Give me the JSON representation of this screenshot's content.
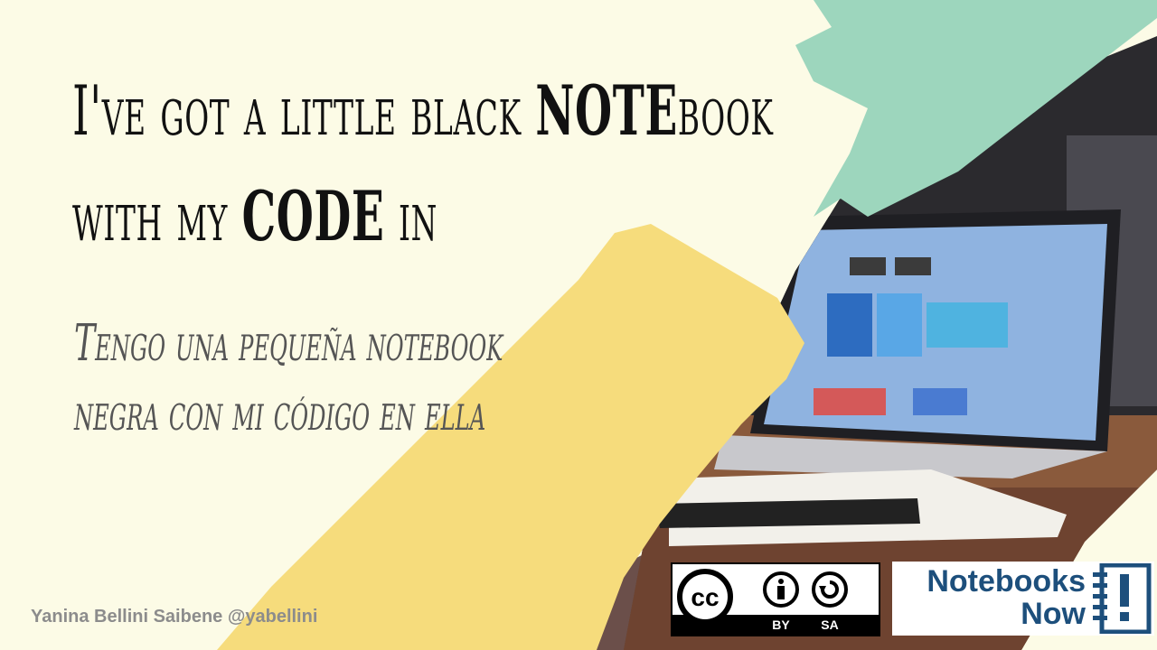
{
  "title": {
    "line1_pre": "I've got a little black ",
    "line1_bold": "NOTE",
    "line1_post": "book",
    "line2_pre": "with my ",
    "line2_bold": "CODE",
    "line2_post": " in"
  },
  "subtitle": {
    "line1": "Tengo una pequeña notebook",
    "line2": "negra con mi código en ella"
  },
  "author": "Yanina Bellini Saibene @yabellini",
  "license": {
    "cc": "cc",
    "by": "BY",
    "sa": "SA"
  },
  "logo": {
    "line1": "Notebooks",
    "line2": "Now"
  },
  "colors": {
    "background": "#fcfbe6",
    "mint": "#9dd6bd",
    "yellow": "#f6dc7c",
    "logo_blue": "#1d4f7c"
  }
}
